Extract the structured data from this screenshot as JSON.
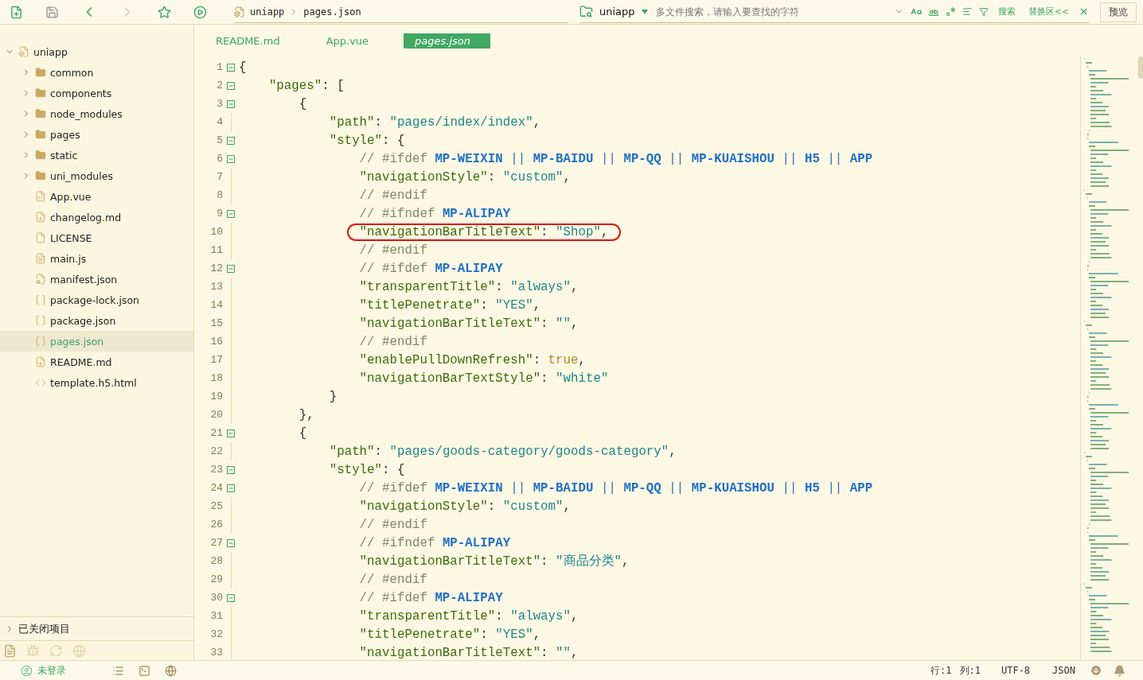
{
  "toolbar": {
    "breadcrumb": [
      "uniapp",
      "pages.json"
    ],
    "search": {
      "project": "uniapp",
      "placeholder": "多文件搜索，请输入要查找的字符",
      "search_label": "搜索",
      "replace_label": "替换区<<"
    },
    "preview_label": "预览"
  },
  "sidebar": {
    "tree": [
      {
        "label": "uniapp",
        "kind": "project",
        "expanded": true,
        "selected": false,
        "children": [
          {
            "label": "common",
            "kind": "folder",
            "expanded": false,
            "selected": false
          },
          {
            "label": "components",
            "kind": "folder",
            "expanded": false,
            "selected": false
          },
          {
            "label": "node_modules",
            "kind": "folder",
            "expanded": false,
            "selected": false
          },
          {
            "label": "pages",
            "kind": "folder",
            "expanded": false,
            "selected": false
          },
          {
            "label": "static",
            "kind": "folder",
            "expanded": false,
            "selected": false
          },
          {
            "label": "uni_modules",
            "kind": "folder",
            "expanded": false,
            "selected": false
          },
          {
            "label": "App.vue",
            "kind": "vue",
            "selected": false
          },
          {
            "label": "changelog.md",
            "kind": "markdown",
            "selected": false
          },
          {
            "label": "LICENSE",
            "kind": "plain",
            "selected": false
          },
          {
            "label": "main.js",
            "kind": "script",
            "selected": false
          },
          {
            "label": "manifest.json",
            "kind": "manifest",
            "selected": false
          },
          {
            "label": "package-lock.json",
            "kind": "json",
            "selected": false
          },
          {
            "label": "package.json",
            "kind": "json",
            "selected": false
          },
          {
            "label": "pages.json",
            "kind": "json",
            "selected": true
          },
          {
            "label": "README.md",
            "kind": "markdown",
            "selected": false
          },
          {
            "label": "template.h5.html",
            "kind": "html",
            "selected": false
          }
        ]
      }
    ],
    "closed_projects": {
      "label": "已关闭项目",
      "expanded": false
    },
    "bottom_tabs": [
      {
        "selected": true
      },
      {
        "selected": false
      },
      {
        "selected": false
      },
      {
        "selected": false
      }
    ]
  },
  "editor": {
    "tabs": [
      {
        "label": "README.md",
        "selected": false
      },
      {
        "label": "App.vue",
        "selected": false
      },
      {
        "label": "pages.json",
        "selected": true
      }
    ],
    "lines": [
      {
        "number": "1",
        "fold": true,
        "tokens": [
          {
            "kind": "punct",
            "text": "{"
          }
        ],
        "children": [
          {
            "number": "2",
            "fold": true,
            "tokens": [
              {
                "kind": "key",
                "text": "\"pages\""
              },
              {
                "kind": "punct",
                "text": ": ["
              }
            ],
            "children": [
              {
                "number": "3",
                "fold": true,
                "tokens": [
                  {
                    "kind": "punct",
                    "text": "{"
                  }
                ],
                "children": [
                  {
                    "number": "4",
                    "fold": false,
                    "tokens": [
                      {
                        "kind": "key",
                        "text": "\"path\""
                      },
                      {
                        "kind": "punct",
                        "text": ": "
                      },
                      {
                        "kind": "string",
                        "text": "\"pages/index/index\""
                      },
                      {
                        "kind": "punct",
                        "text": ","
                      }
                    ]
                  },
                  {
                    "number": "5",
                    "fold": true,
                    "tokens": [
                      {
                        "kind": "key",
                        "text": "\"style\""
                      },
                      {
                        "kind": "punct",
                        "text": ": {"
                      }
                    ],
                    "children": [
                      {
                        "number": "6",
                        "fold": true,
                        "tokens": [
                          {
                            "kind": "comment",
                            "text": "// #ifdef "
                          },
                          {
                            "kind": "directive",
                            "text": "MP-WEIXIN"
                          },
                          {
                            "kind": "operator",
                            "text": " || "
                          },
                          {
                            "kind": "directive",
                            "text": "MP-BAIDU"
                          },
                          {
                            "kind": "operator",
                            "text": " || "
                          },
                          {
                            "kind": "directive",
                            "text": "MP-QQ"
                          },
                          {
                            "kind": "operator",
                            "text": " || "
                          },
                          {
                            "kind": "directive",
                            "text": "MP-KUAISHOU"
                          },
                          {
                            "kind": "operator",
                            "text": " || "
                          },
                          {
                            "kind": "directive",
                            "text": "H5"
                          },
                          {
                            "kind": "operator",
                            "text": " || "
                          },
                          {
                            "kind": "directive",
                            "text": "APP"
                          }
                        ]
                      },
                      {
                        "number": "7",
                        "fold": false,
                        "tokens": [
                          {
                            "kind": "key",
                            "text": "\"navigationStyle\""
                          },
                          {
                            "kind": "punct",
                            "text": ": "
                          },
                          {
                            "kind": "string",
                            "text": "\"custom\""
                          },
                          {
                            "kind": "punct",
                            "text": ","
                          }
                        ]
                      },
                      {
                        "number": "8",
                        "fold": false,
                        "tokens": [
                          {
                            "kind": "comment",
                            "text": "// #endif"
                          }
                        ]
                      },
                      {
                        "number": "9",
                        "fold": true,
                        "tokens": [
                          {
                            "kind": "comment",
                            "text": "// #ifndef "
                          },
                          {
                            "kind": "directive",
                            "text": "MP-ALIPAY"
                          }
                        ]
                      },
                      {
                        "number": "10",
                        "fold": false,
                        "circled": true,
                        "tokens": [
                          {
                            "kind": "key",
                            "text": "\"navigationBarTitleText\""
                          },
                          {
                            "kind": "punct",
                            "text": ": "
                          },
                          {
                            "kind": "string",
                            "text": "\"Shop\""
                          },
                          {
                            "kind": "punct",
                            "text": ","
                          }
                        ]
                      },
                      {
                        "number": "11",
                        "fold": false,
                        "tokens": [
                          {
                            "kind": "comment",
                            "text": "// #endif"
                          }
                        ]
                      },
                      {
                        "number": "12",
                        "fold": true,
                        "tokens": [
                          {
                            "kind": "comment",
                            "text": "// #ifdef "
                          },
                          {
                            "kind": "directive",
                            "text": "MP-ALIPAY"
                          }
                        ]
                      },
                      {
                        "number": "13",
                        "fold": false,
                        "tokens": [
                          {
                            "kind": "key",
                            "text": "\"transparentTitle\""
                          },
                          {
                            "kind": "punct",
                            "text": ": "
                          },
                          {
                            "kind": "string",
                            "text": "\"always\""
                          },
                          {
                            "kind": "punct",
                            "text": ","
                          }
                        ]
                      },
                      {
                        "number": "14",
                        "fold": false,
                        "tokens": [
                          {
                            "kind": "key",
                            "text": "\"titlePenetrate\""
                          },
                          {
                            "kind": "punct",
                            "text": ": "
                          },
                          {
                            "kind": "string",
                            "text": "\"YES\""
                          },
                          {
                            "kind": "punct",
                            "text": ","
                          }
                        ]
                      },
                      {
                        "number": "15",
                        "fold": false,
                        "tokens": [
                          {
                            "kind": "key",
                            "text": "\"navigationBarTitleText\""
                          },
                          {
                            "kind": "punct",
                            "text": ": "
                          },
                          {
                            "kind": "string",
                            "text": "\"\""
                          },
                          {
                            "kind": "punct",
                            "text": ","
                          }
                        ]
                      },
                      {
                        "number": "16",
                        "fold": false,
                        "tokens": [
                          {
                            "kind": "comment",
                            "text": "// #endif"
                          }
                        ]
                      },
                      {
                        "number": "17",
                        "fold": false,
                        "tokens": [
                          {
                            "kind": "key",
                            "text": "\"enablePullDownRefresh\""
                          },
                          {
                            "kind": "punct",
                            "text": ": "
                          },
                          {
                            "kind": "literal",
                            "text": "true"
                          },
                          {
                            "kind": "punct",
                            "text": ","
                          }
                        ]
                      },
                      {
                        "number": "18",
                        "fold": false,
                        "tokens": [
                          {
                            "kind": "key",
                            "text": "\"navigationBarTextStyle\""
                          },
                          {
                            "kind": "punct",
                            "text": ": "
                          },
                          {
                            "kind": "string",
                            "text": "\"white\""
                          }
                        ]
                      }
                    ]
                  },
                  {
                    "number": "19",
                    "fold": false,
                    "tokens": [
                      {
                        "kind": "punct",
                        "text": "}"
                      }
                    ]
                  }
                ]
              },
              {
                "number": "20",
                "fold": false,
                "tokens": [
                  {
                    "kind": "punct",
                    "text": "},"
                  }
                ]
              },
              {
                "number": "21",
                "fold": true,
                "tokens": [
                  {
                    "kind": "punct",
                    "text": "{"
                  }
                ],
                "children": [
                  {
                    "number": "22",
                    "fold": false,
                    "tokens": [
                      {
                        "kind": "key",
                        "text": "\"path\""
                      },
                      {
                        "kind": "punct",
                        "text": ": "
                      },
                      {
                        "kind": "string",
                        "text": "\"pages/goods-category/goods-category\""
                      },
                      {
                        "kind": "punct",
                        "text": ","
                      }
                    ]
                  },
                  {
                    "number": "23",
                    "fold": true,
                    "tokens": [
                      {
                        "kind": "key",
                        "text": "\"style\""
                      },
                      {
                        "kind": "punct",
                        "text": ": {"
                      }
                    ],
                    "children": [
                      {
                        "number": "24",
                        "fold": true,
                        "tokens": [
                          {
                            "kind": "comment",
                            "text": "// #ifdef "
                          },
                          {
                            "kind": "directive",
                            "text": "MP-WEIXIN"
                          },
                          {
                            "kind": "operator",
                            "text": " || "
                          },
                          {
                            "kind": "directive",
                            "text": "MP-BAIDU"
                          },
                          {
                            "kind": "operator",
                            "text": " || "
                          },
                          {
                            "kind": "directive",
                            "text": "MP-QQ"
                          },
                          {
                            "kind": "operator",
                            "text": " || "
                          },
                          {
                            "kind": "directive",
                            "text": "MP-KUAISHOU"
                          },
                          {
                            "kind": "operator",
                            "text": " || "
                          },
                          {
                            "kind": "directive",
                            "text": "H5"
                          },
                          {
                            "kind": "operator",
                            "text": " || "
                          },
                          {
                            "kind": "directive",
                            "text": "APP"
                          }
                        ]
                      },
                      {
                        "number": "25",
                        "fold": false,
                        "tokens": [
                          {
                            "kind": "key",
                            "text": "\"navigationStyle\""
                          },
                          {
                            "kind": "punct",
                            "text": ": "
                          },
                          {
                            "kind": "string",
                            "text": "\"custom\""
                          },
                          {
                            "kind": "punct",
                            "text": ","
                          }
                        ]
                      },
                      {
                        "number": "26",
                        "fold": false,
                        "tokens": [
                          {
                            "kind": "comment",
                            "text": "// #endif"
                          }
                        ]
                      },
                      {
                        "number": "27",
                        "fold": true,
                        "tokens": [
                          {
                            "kind": "comment",
                            "text": "// #ifndef "
                          },
                          {
                            "kind": "directive",
                            "text": "MP-ALIPAY"
                          }
                        ]
                      },
                      {
                        "number": "28",
                        "fold": false,
                        "tokens": [
                          {
                            "kind": "key",
                            "text": "\"navigationBarTitleText\""
                          },
                          {
                            "kind": "punct",
                            "text": ": "
                          },
                          {
                            "kind": "string",
                            "text": "\"商品分类\""
                          },
                          {
                            "kind": "punct",
                            "text": ","
                          }
                        ]
                      },
                      {
                        "number": "29",
                        "fold": false,
                        "tokens": [
                          {
                            "kind": "comment",
                            "text": "// #endif"
                          }
                        ]
                      },
                      {
                        "number": "30",
                        "fold": true,
                        "tokens": [
                          {
                            "kind": "comment",
                            "text": "// #ifdef "
                          },
                          {
                            "kind": "directive",
                            "text": "MP-ALIPAY"
                          }
                        ]
                      },
                      {
                        "number": "31",
                        "fold": false,
                        "tokens": [
                          {
                            "kind": "key",
                            "text": "\"transparentTitle\""
                          },
                          {
                            "kind": "punct",
                            "text": ": "
                          },
                          {
                            "kind": "string",
                            "text": "\"always\""
                          },
                          {
                            "kind": "punct",
                            "text": ","
                          }
                        ]
                      },
                      {
                        "number": "32",
                        "fold": false,
                        "tokens": [
                          {
                            "kind": "key",
                            "text": "\"titlePenetrate\""
                          },
                          {
                            "kind": "punct",
                            "text": ": "
                          },
                          {
                            "kind": "string",
                            "text": "\"YES\""
                          },
                          {
                            "kind": "punct",
                            "text": ","
                          }
                        ]
                      },
                      {
                        "number": "33",
                        "fold": false,
                        "tokens": [
                          {
                            "kind": "key",
                            "text": "\"navigationBarTitleText\""
                          },
                          {
                            "kind": "punct",
                            "text": ": "
                          },
                          {
                            "kind": "string",
                            "text": "\"\""
                          },
                          {
                            "kind": "punct",
                            "text": ","
                          }
                        ]
                      }
                    ]
                  }
                ]
              }
            ]
          }
        ]
      }
    ]
  },
  "status_bar": {
    "user": "未登录",
    "position": [
      "行:1",
      "列:1"
    ],
    "encoding": "UTF-8",
    "language": "JSON"
  }
}
